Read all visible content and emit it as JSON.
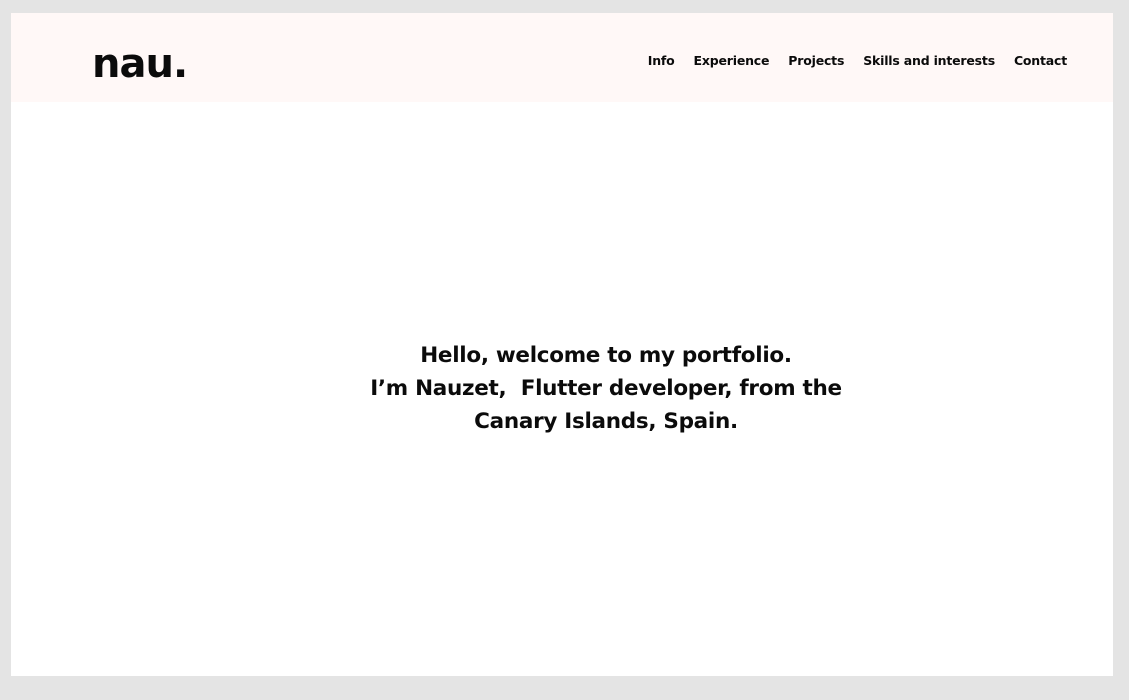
{
  "header": {
    "logo": "nau.",
    "nav": [
      {
        "label": "Info"
      },
      {
        "label": "Experience"
      },
      {
        "label": "Projects"
      },
      {
        "label": "Skills and interests"
      },
      {
        "label": "Contact"
      }
    ]
  },
  "hero": {
    "lines": [
      "Hello, welcome to my portfolio.",
      "I’m Nauzet,  Flutter developer, from the",
      "Canary Islands, Spain."
    ]
  },
  "colors": {
    "outer_background": "#e4e4e4",
    "header_background": "#fff8f7",
    "page_background": "#ffffff",
    "text": "#0b0b0b"
  }
}
